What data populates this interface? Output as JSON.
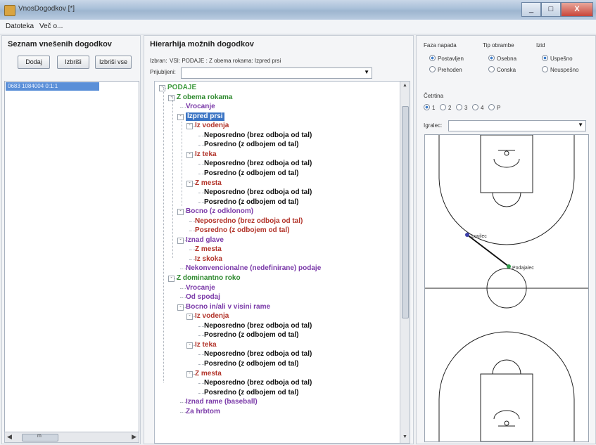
{
  "window": {
    "title": "VnosDogodkov [*]",
    "controls": [
      "_",
      "□",
      "X"
    ]
  },
  "menu": [
    "Datoteka",
    "Več o..."
  ],
  "left": {
    "title": "Seznam vnešenih dogodkov",
    "buttons": [
      "Dodaj",
      "Izbriši",
      "Izbriši vse"
    ],
    "items": [
      "0683 1084004              0:1:1"
    ],
    "scroll_thumb": "m"
  },
  "mid": {
    "title": "Hierarhija možnih dogodkov",
    "selected_label": "Izbran:",
    "selected_value": "VSI: PODAJE : Z obema rokama: Izpred prsi",
    "filter_label": "Prijubljeni:",
    "tree": [
      {
        "d": 0,
        "t": "PODAJE",
        "c": "#3d9a3d",
        "e": "-"
      },
      {
        "d": 1,
        "t": "Z obema rokama",
        "c": "#2f8a2f",
        "e": "-"
      },
      {
        "d": 2,
        "t": "Vrocanje",
        "c": "#7a39a8"
      },
      {
        "d": 2,
        "t": "Izpred prsi",
        "c": "#ffffff",
        "e": "-",
        "sel": true
      },
      {
        "d": 3,
        "t": "Iz vodenja",
        "c": "#b2342a",
        "e": "-"
      },
      {
        "d": 4,
        "t": "Neposredno (brez odboja od tal)",
        "c": "#111111"
      },
      {
        "d": 4,
        "t": "Posredno (z odbojem od tal)",
        "c": "#111111"
      },
      {
        "d": 3,
        "t": "Iz teka",
        "c": "#b2342a",
        "e": "-"
      },
      {
        "d": 4,
        "t": "Neposredno (brez odboja od tal)",
        "c": "#111111"
      },
      {
        "d": 4,
        "t": "Posredno (z odbojem od tal)",
        "c": "#111111"
      },
      {
        "d": 3,
        "t": "Z mesta",
        "c": "#b2342a",
        "e": "-"
      },
      {
        "d": 4,
        "t": "Neposredno (brez odboja od tal)",
        "c": "#111111"
      },
      {
        "d": 4,
        "t": "Posredno (z odbojem od tal)",
        "c": "#111111"
      },
      {
        "d": 2,
        "t": "Bocno (z odklonom)",
        "c": "#7a39a8",
        "e": "-"
      },
      {
        "d": 3,
        "t": "Neposredno (brez odboja od tal)",
        "c": "#b2342a"
      },
      {
        "d": 3,
        "t": "Posredno (z odbojem od tal)",
        "c": "#b2342a"
      },
      {
        "d": 2,
        "t": "Iznad glave",
        "c": "#7a39a8",
        "e": "-"
      },
      {
        "d": 3,
        "t": "Z mesta",
        "c": "#b2342a"
      },
      {
        "d": 3,
        "t": "Iz skoka",
        "c": "#b2342a"
      },
      {
        "d": 2,
        "t": "Nekonvencionalne (nedefinirane) podaje",
        "c": "#7a39a8"
      },
      {
        "d": 1,
        "t": "Z dominantno roko",
        "c": "#2f8a2f",
        "e": "-"
      },
      {
        "d": 2,
        "t": "Vrocanje",
        "c": "#7a39a8"
      },
      {
        "d": 2,
        "t": "Od spodaj",
        "c": "#7a39a8"
      },
      {
        "d": 2,
        "t": "Bocno in/ali v visini rame",
        "c": "#7a39a8",
        "e": "-"
      },
      {
        "d": 3,
        "t": "Iz vodenja",
        "c": "#b2342a",
        "e": "-"
      },
      {
        "d": 4,
        "t": "Neposredno (brez odboja od tal)",
        "c": "#111111"
      },
      {
        "d": 4,
        "t": "Posredno (z odbojem od tal)",
        "c": "#111111"
      },
      {
        "d": 3,
        "t": "Iz teka",
        "c": "#b2342a",
        "e": "-"
      },
      {
        "d": 4,
        "t": "Neposredno (brez odboja od tal)",
        "c": "#111111"
      },
      {
        "d": 4,
        "t": "Posredno (z odbojem od tal)",
        "c": "#111111"
      },
      {
        "d": 3,
        "t": "Z mesta",
        "c": "#b2342a",
        "e": "-"
      },
      {
        "d": 4,
        "t": "Neposredno (brez odboja od tal)",
        "c": "#111111"
      },
      {
        "d": 4,
        "t": "Posredno (z odbojem od tal)",
        "c": "#111111"
      },
      {
        "d": 2,
        "t": "Iznad rame (baseball)",
        "c": "#7a39a8"
      },
      {
        "d": 2,
        "t": "Za hrbtom",
        "c": "#7a39a8"
      }
    ]
  },
  "right": {
    "groups": [
      {
        "title": "Faza napada",
        "options": [
          "Postavljen",
          "Prehoden"
        ],
        "selected": 0
      },
      {
        "title": "Tip obrambe",
        "options": [
          "Osebna",
          "Conska"
        ],
        "selected": 0
      },
      {
        "title": "Izid",
        "options": [
          "Uspešno",
          "Neuspešno"
        ],
        "selected": 0
      }
    ],
    "quarter_title": "Četrtina",
    "quarters": [
      "1",
      "2",
      "3",
      "4",
      "P"
    ],
    "quarter_selected": 0,
    "player_label": "Igralec:",
    "court": {
      "label_from": "Lovilec",
      "label_to": "Podajalec"
    }
  },
  "colors": {
    "selection": "#3a74c4",
    "accent": "#5a8fd8"
  }
}
